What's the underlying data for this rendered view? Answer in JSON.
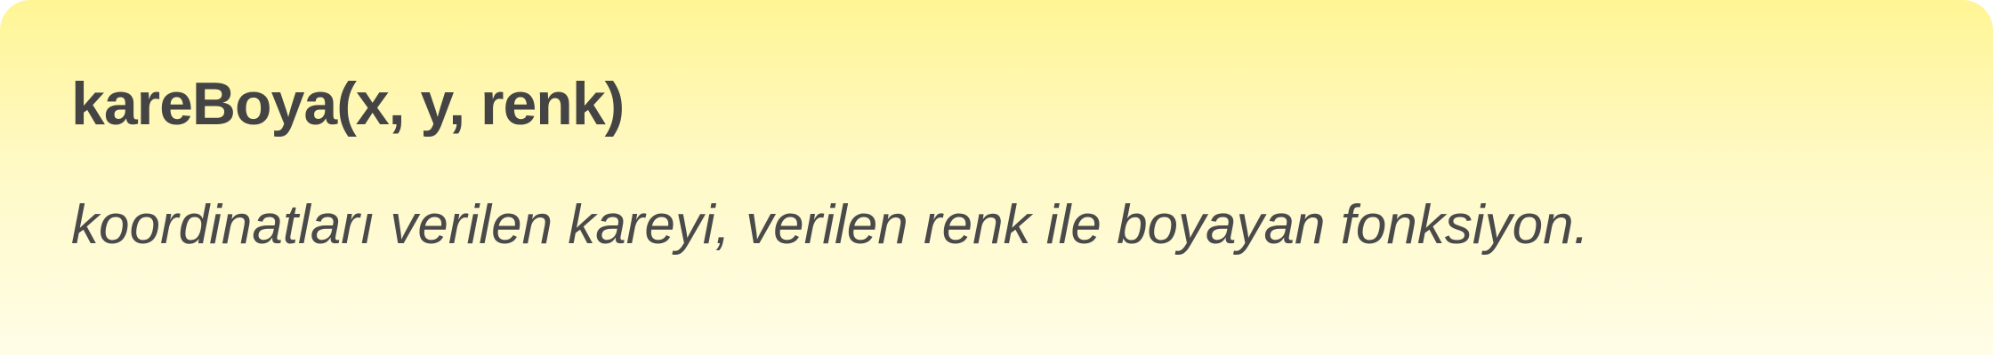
{
  "card": {
    "title": "kareBoya(x, y, renk)",
    "description": "koordinatları verilen kareyi, verilen renk ile boyayan fonksiyon."
  }
}
